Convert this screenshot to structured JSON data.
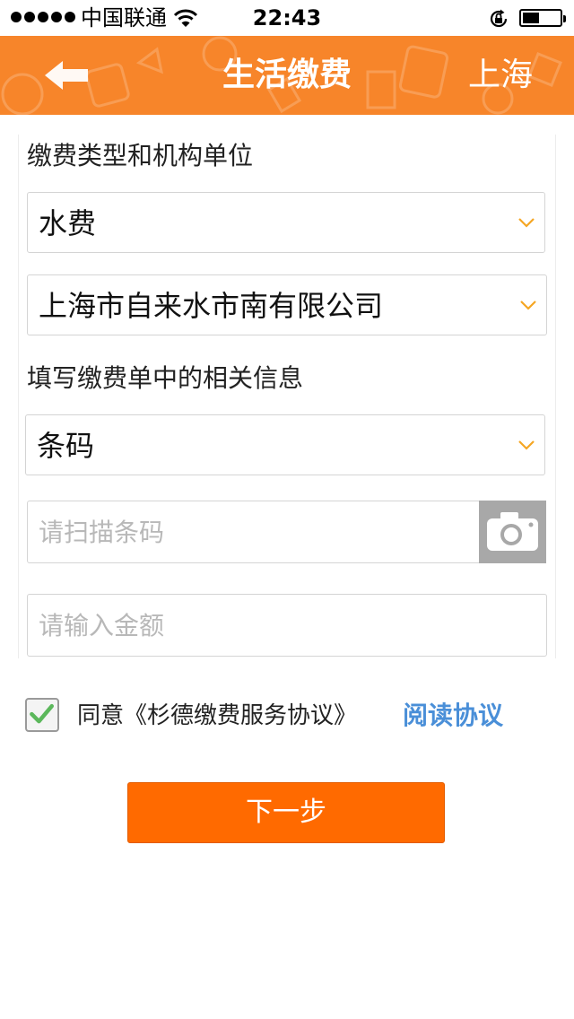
{
  "status_bar": {
    "carrier": "中国联通",
    "time": "22:43",
    "battery_level": 0.45
  },
  "nav": {
    "title": "生活缴费",
    "city": "上海"
  },
  "form": {
    "section1_label": "缴费类型和机构单位",
    "payment_type": "水费",
    "institution": "上海市自来水市南有限公司",
    "section2_label": "填写缴费单中的相关信息",
    "code_type": "条码",
    "barcode_placeholder": "请扫描条码",
    "amount_placeholder": "请输入金额"
  },
  "agreement": {
    "checked": true,
    "text": "同意《杉德缴费服务协议》",
    "link": "阅读协议"
  },
  "next_button": "下一步",
  "colors": {
    "brand_orange": "#f7852a",
    "button_orange": "#ff6a00",
    "link_blue": "#4a8fd8",
    "chevron_orange": "#f5a623",
    "check_green": "#5cb85c"
  }
}
